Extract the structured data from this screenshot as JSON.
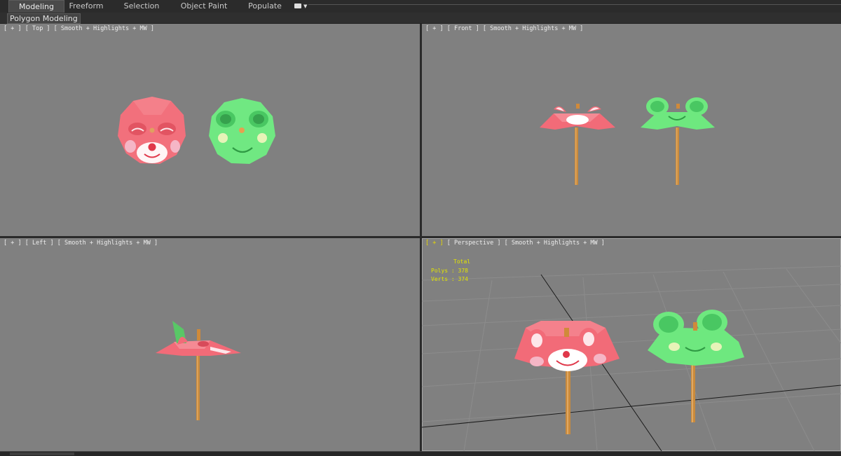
{
  "ribbon": {
    "tabs": [
      {
        "label": "Modeling",
        "active": true
      },
      {
        "label": "Freeform",
        "active": false
      },
      {
        "label": "Selection",
        "active": false
      },
      {
        "label": "Object Paint",
        "active": false
      },
      {
        "label": "Populate",
        "active": false
      }
    ],
    "panel_label": "Polygon Modeling"
  },
  "viewports": {
    "top": {
      "plus": "[ + ]",
      "name": "[ Top ]",
      "shading": "[ Smooth + Highlights + MW ]"
    },
    "front": {
      "plus": "[ + ]",
      "name": "[ Front ]",
      "shading": "[ Smooth + Highlights + MW ]"
    },
    "left": {
      "plus": "[ + ]",
      "name": "[ Left ]",
      "shading": "[ Smooth + Highlights + MW ]"
    },
    "perspective": {
      "plus": "[ + ]",
      "name": "[ Perspective ]",
      "shading": "[ Smooth + Highlights + MW ]"
    }
  },
  "stats": {
    "total_label": "Total",
    "polys_label": "Polys",
    "polys_value": "378",
    "verts_label": "Verts",
    "verts_value": "374"
  },
  "colors": {
    "viewport_bg": "#808080",
    "umbrella_red": "#f26b78",
    "umbrella_green": "#6ee87f",
    "handle": "#c98a3c",
    "stats_yellow": "#e2e400"
  }
}
